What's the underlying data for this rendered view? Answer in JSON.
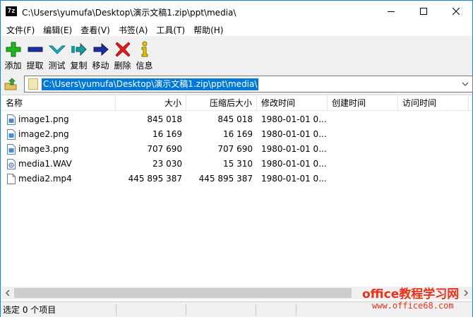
{
  "window": {
    "title": "C:\\Users\\yumufa\\Desktop\\演示文稿1.zip\\ppt\\media\\",
    "app_icon_text": "7z"
  },
  "menu": [
    {
      "label": "文件(F)"
    },
    {
      "label": "编辑(E)"
    },
    {
      "label": "查看(V)"
    },
    {
      "label": "书签(A)"
    },
    {
      "label": "工具(T)"
    },
    {
      "label": "帮助(H)"
    }
  ],
  "toolbar": [
    {
      "label": "添加",
      "icon": "plus-icon",
      "color": "#22b422"
    },
    {
      "label": "提取",
      "icon": "minus-icon",
      "color": "#1c2f9e"
    },
    {
      "label": "测试",
      "icon": "check-chevron-icon",
      "color": "#1fb7c9"
    },
    {
      "label": "复制",
      "icon": "copy-arrow-icon",
      "color": "#1a9aa0"
    },
    {
      "label": "移动",
      "icon": "move-arrow-icon",
      "color": "#1c2f9e"
    },
    {
      "label": "删除",
      "icon": "delete-x-icon",
      "color": "#e01d1d"
    },
    {
      "label": "信息",
      "icon": "info-icon",
      "color": "#e8c600"
    }
  ],
  "address": {
    "path": "C:\\Users\\yumufa\\Desktop\\演示文稿1.zip\\ppt\\media\\"
  },
  "columns": [
    {
      "label": "名称"
    },
    {
      "label": "大小"
    },
    {
      "label": "压缩后大小"
    },
    {
      "label": "修改时间"
    },
    {
      "label": "创建时间"
    },
    {
      "label": "访问时间"
    }
  ],
  "files": [
    {
      "name": "image1.png",
      "size": "845 018",
      "packed": "845 018",
      "modified": "1980-01-01 0...",
      "created": "",
      "accessed": "",
      "icon": "image-file-icon"
    },
    {
      "name": "image2.png",
      "size": "16 169",
      "packed": "16 169",
      "modified": "1980-01-01 0...",
      "created": "",
      "accessed": "",
      "icon": "image-file-icon"
    },
    {
      "name": "image3.png",
      "size": "707 690",
      "packed": "707 690",
      "modified": "1980-01-01 0...",
      "created": "",
      "accessed": "",
      "icon": "image-file-icon"
    },
    {
      "name": "media1.WAV",
      "size": "23 030",
      "packed": "15 310",
      "modified": "1980-01-01 0...",
      "created": "",
      "accessed": "",
      "icon": "audio-file-icon"
    },
    {
      "name": "media2.mp4",
      "size": "445 895 387",
      "packed": "445 895 387",
      "modified": "1980-01-01 0...",
      "created": "",
      "accessed": "",
      "icon": "generic-file-icon"
    }
  ],
  "status": {
    "selected": "选定 0 个项目",
    "cell2": "",
    "cell3": "",
    "cell4": ""
  },
  "watermark": {
    "line1": "office教程学习网",
    "line2": "www.office68.com"
  },
  "colors": {
    "selection": "#0078d7",
    "border": "#1883d7",
    "watermark": "#e8331a"
  }
}
